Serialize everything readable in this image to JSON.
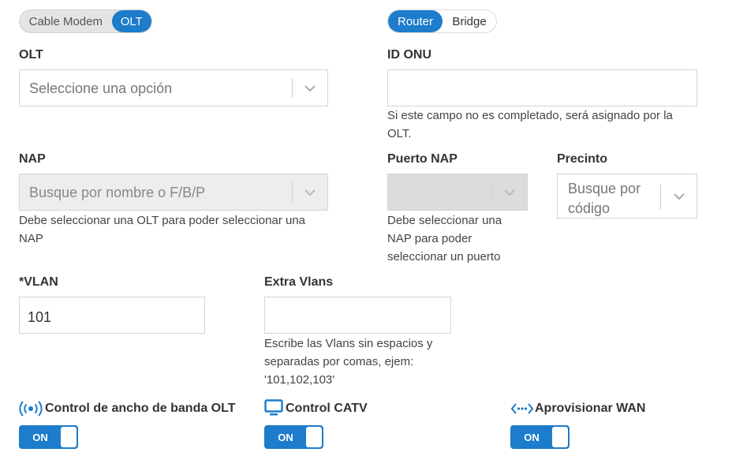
{
  "device_type": {
    "options": [
      "Cable Modem",
      "OLT"
    ],
    "selected": "OLT"
  },
  "mode": {
    "options": [
      "Router",
      "Bridge"
    ],
    "selected": "Router"
  },
  "olt": {
    "label": "OLT",
    "placeholder": "Seleccione una opción"
  },
  "id_onu": {
    "label": "ID ONU",
    "value": "",
    "help": [
      "Si este campo no es completado, será asignado por la",
      "OLT."
    ]
  },
  "nap": {
    "label": "NAP",
    "placeholder": "Busque por nombre o F/B/P",
    "help": [
      "Debe seleccionar una OLT para poder seleccionar una",
      "NAP"
    ]
  },
  "puerto_nap": {
    "label": "Puerto NAP",
    "help": [
      "Debe seleccionar una",
      "NAP para poder",
      "seleccionar un puerto"
    ]
  },
  "precinto": {
    "label": "Precinto",
    "placeholder": [
      "Busque por",
      "código"
    ]
  },
  "vlan": {
    "label": "*VLAN",
    "value": "101"
  },
  "extra_vlans": {
    "label": "Extra Vlans",
    "value": "",
    "help": [
      "Escribe las Vlans sin espacios y",
      "separadas por comas, ejem:",
      "'101,102,103'"
    ]
  },
  "toggles": [
    {
      "label": "Control de ancho de banda OLT",
      "state": "ON",
      "icon": "broadcast-icon"
    },
    {
      "label": "Control CATV",
      "state": "ON",
      "icon": "tv-icon"
    },
    {
      "label": "Aprovisionar WAN",
      "state": "ON",
      "icon": "network-icon"
    }
  ],
  "colors": {
    "accent": "#1d7ccb",
    "disabled_bg": "#ededed"
  }
}
